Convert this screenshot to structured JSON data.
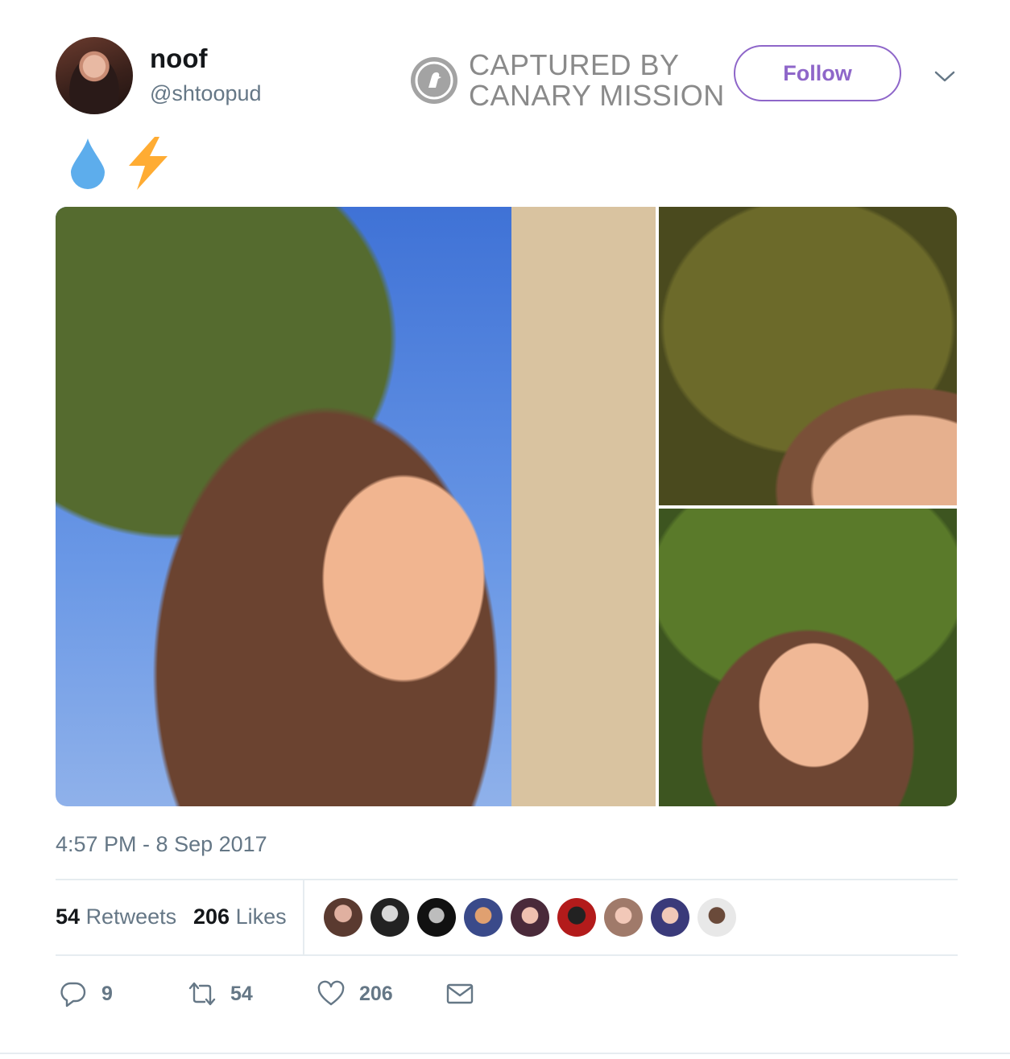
{
  "tweet": {
    "display_name": "noof",
    "handle": "@shtoopud",
    "follow_label": "Follow",
    "text_emojis": [
      "droplet",
      "high-voltage"
    ],
    "timestamp": "4:57 PM - 8 Sep 2017"
  },
  "watermark": {
    "line1": "CAPTURED BY",
    "line2": "CANARY MISSION"
  },
  "stats": {
    "retweets_count": "54",
    "retweets_label": "Retweets",
    "likes_count": "206",
    "likes_label": "Likes"
  },
  "actions": {
    "reply_count": "9",
    "retweet_count": "54",
    "like_count": "206"
  },
  "colors": {
    "accent": "#8e66c9",
    "secondary_text": "#657786",
    "divider": "#e6ecf0"
  },
  "icons": {
    "reply": "reply-icon",
    "retweet": "retweet-icon",
    "like": "heart-icon",
    "message": "envelope-icon",
    "menu": "chevron-down-icon"
  }
}
